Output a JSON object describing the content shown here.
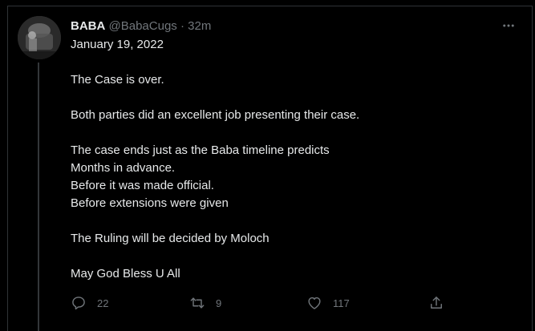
{
  "tweet": {
    "author": {
      "display_name": "BABA",
      "handle": "@BabaCugs",
      "avatar_icon": "profile-avatar"
    },
    "separator": "·",
    "time": "32m",
    "more_icon": "more-horizontal-icon",
    "body_lines": [
      "January 19, 2022",
      "",
      "The Case is over.",
      "",
      "Both parties did an excellent job presenting their case.",
      "",
      "The case ends just as the Baba timeline predicts",
      "Months in advance.",
      "Before it was made official.",
      "Before extensions were given",
      "",
      "The Ruling will be decided by Moloch",
      "",
      "May God Bless U All"
    ],
    "actions": {
      "reply": {
        "icon": "reply-icon",
        "count": "22"
      },
      "retweet": {
        "icon": "retweet-icon",
        "count": "9"
      },
      "like": {
        "icon": "heart-icon",
        "count": "117"
      },
      "share": {
        "icon": "share-icon"
      }
    }
  },
  "colors": {
    "background": "#000000",
    "text_primary": "#e7e9ea",
    "text_secondary": "#71767b",
    "border": "#2f3336"
  }
}
